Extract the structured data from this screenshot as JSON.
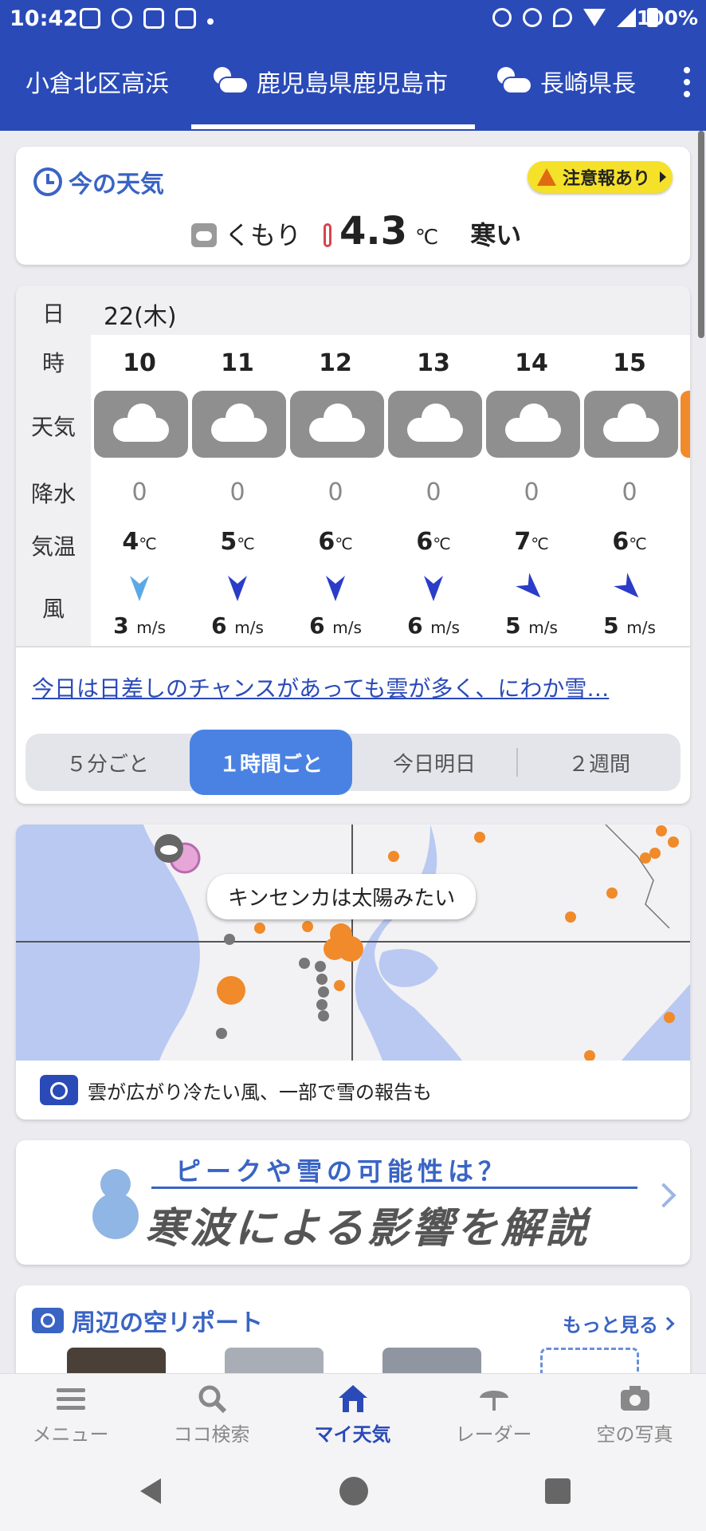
{
  "status": {
    "time": "10:42",
    "battery": "100%"
  },
  "tabs": [
    {
      "label": "小倉北区高浜"
    },
    {
      "label": "鹿児島県鹿児島市"
    },
    {
      "label": "長崎県長"
    }
  ],
  "current": {
    "title": "今の天気",
    "alert": "注意報あり",
    "condition": "くもり",
    "temp": "4.3",
    "temp_unit": "℃",
    "feel": "寒い"
  },
  "hourly": {
    "row_labels": {
      "day": "日",
      "hour": "時",
      "weather": "天気",
      "rain": "降水",
      "temp": "気温",
      "wind": "風"
    },
    "day": "22(木)",
    "hours": [
      {
        "hour": "10",
        "weather": "cloud-icon",
        "rain": "0",
        "temp": "4",
        "wind_speed": "3",
        "wind_color": "#5aa9e6",
        "wind_dir_deg": 180
      },
      {
        "hour": "11",
        "weather": "cloud-icon",
        "rain": "0",
        "temp": "5",
        "wind_speed": "6",
        "wind_color": "#2a3cc8",
        "wind_dir_deg": 180
      },
      {
        "hour": "12",
        "weather": "cloud-icon",
        "rain": "0",
        "temp": "6",
        "wind_speed": "6",
        "wind_color": "#2a3cc8",
        "wind_dir_deg": 180
      },
      {
        "hour": "13",
        "weather": "cloud-icon",
        "rain": "0",
        "temp": "6",
        "wind_speed": "6",
        "wind_color": "#2a3cc8",
        "wind_dir_deg": 180
      },
      {
        "hour": "14",
        "weather": "cloud-icon",
        "rain": "0",
        "temp": "7",
        "wind_speed": "5",
        "wind_color": "#2a3cc8",
        "wind_dir_deg": 135
      },
      {
        "hour": "15",
        "weather": "cloud-icon",
        "rain": "0",
        "temp": "6",
        "wind_speed": "5",
        "wind_color": "#2a3cc8",
        "wind_dir_deg": 135
      }
    ],
    "temp_unit": "℃",
    "wind_unit": "m/s",
    "summary": "今日は日差しのチャンスがあっても雲が多く、にわか雪…",
    "segments": [
      "５分ごと",
      "１時間ごと",
      "今日明日",
      "２週間"
    ],
    "active_segment": "１時間ごと"
  },
  "map": {
    "bubble": "キンセンカは太陽みたい",
    "caption": "雲が広がり冷たい風、一部で雪の報告も"
  },
  "banner": {
    "line1": "ピークや雪の可能性は？",
    "line2": "寒波による影響を解説"
  },
  "nearby": {
    "title": "周辺の空リポート",
    "more": "もっと見る"
  },
  "bottom_nav": [
    {
      "label": "メニュー",
      "icon": "menu-icon"
    },
    {
      "label": "ココ検索",
      "icon": "search-icon"
    },
    {
      "label": "マイ天気",
      "icon": "home-icon"
    },
    {
      "label": "レーダー",
      "icon": "umbrella-radar-icon"
    },
    {
      "label": "空の写真",
      "icon": "camera-icon"
    }
  ],
  "colors": {
    "brand_blue": "#2a4ab8",
    "accent_blue": "#4a82e4",
    "alert_yellow": "#f5e12a",
    "map_water": "#b9c9f2",
    "report_orange": "#f08a2a"
  }
}
